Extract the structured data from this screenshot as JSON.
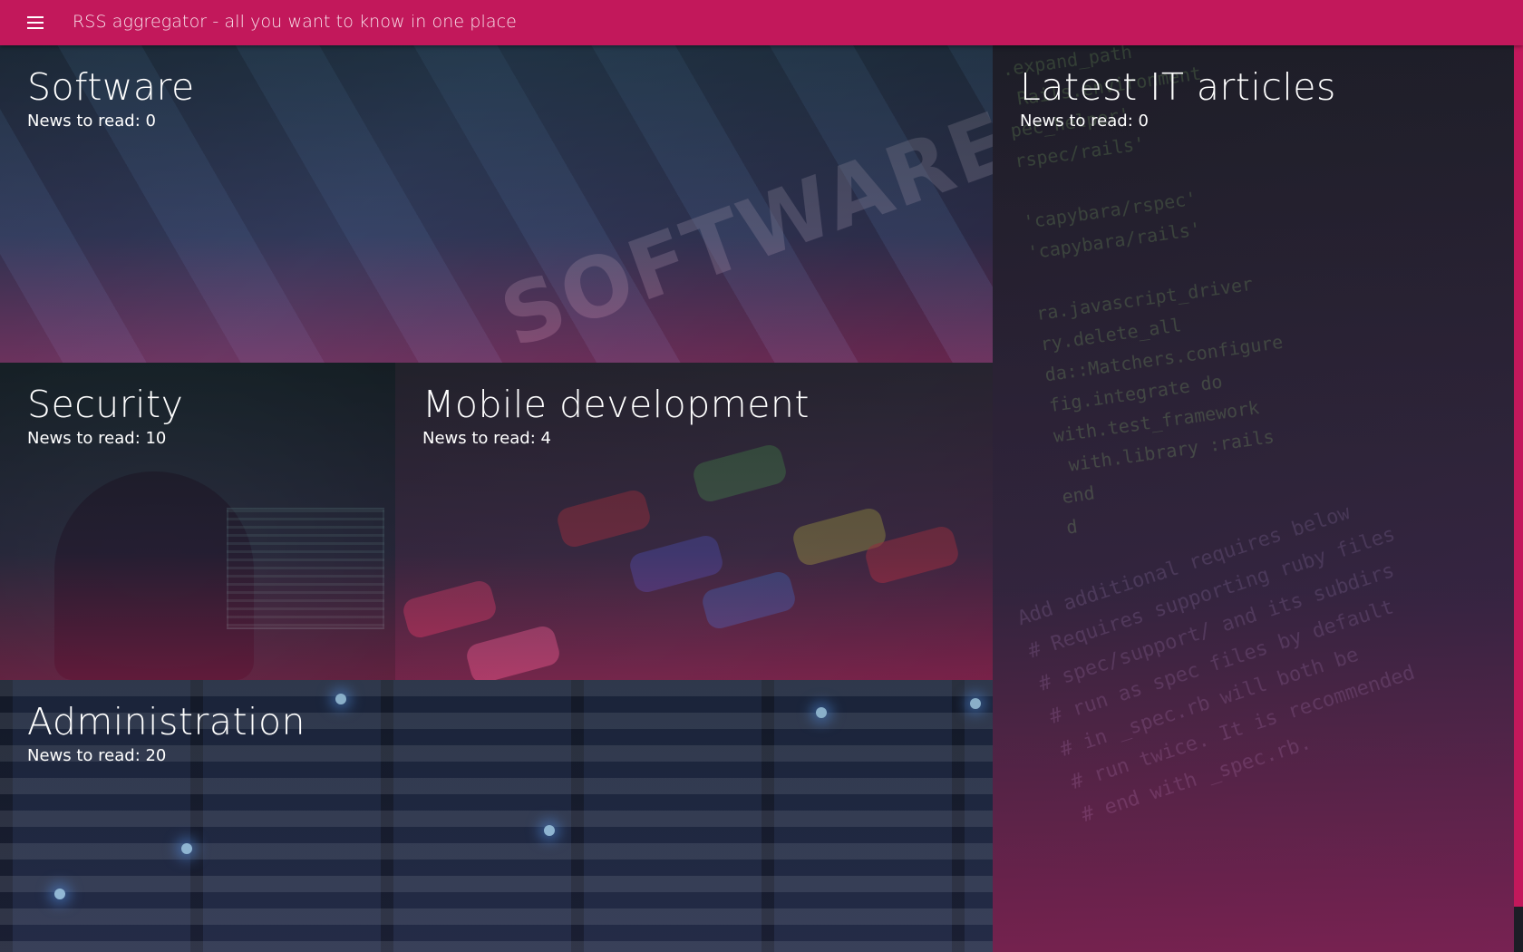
{
  "app": {
    "title": "RSS aggregator - all you want to know in one place",
    "menu_icon": "hamburger-menu-icon",
    "accent_color": "#c2185b"
  },
  "tiles": [
    {
      "title": "Software",
      "count_label": "News to read: 0"
    },
    {
      "title": "Latest IT articles",
      "count_label": "News to read: 0"
    },
    {
      "title": "Security",
      "count_label": "News to read: 10"
    },
    {
      "title": "Mobile development",
      "count_label": "News to read: 4"
    },
    {
      "title": "Administration",
      "count_label": "News to read: 20"
    }
  ]
}
